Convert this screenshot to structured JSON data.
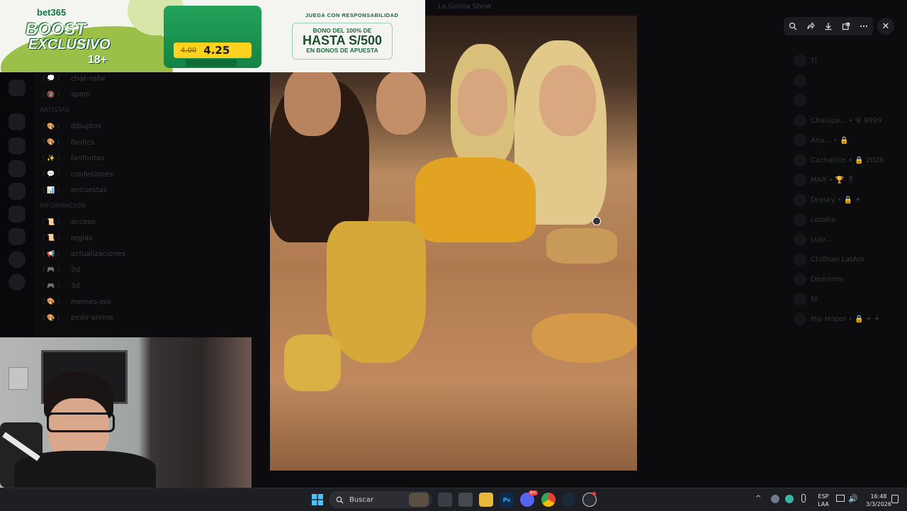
{
  "window": {
    "title": "La Gotita Show"
  },
  "sidebar": {
    "channels": [
      {
        "icon": "[ 💭 ]",
        "name": "chat-nsfw"
      },
      {
        "icon": "[ 🔞 ]",
        "name": "spam"
      },
      {
        "icon": "",
        "name": "ARTISTAS",
        "category": true
      },
      {
        "icon": "[ 🎨 ]",
        "name": "dibujitos"
      },
      {
        "icon": "[ 🎨 ]",
        "name": "fanfics"
      },
      {
        "icon": "[ ✨ ]",
        "name": "fanfontas"
      },
      {
        "icon": "[ 💬 ]",
        "name": "confesiones"
      },
      {
        "icon": "[ 📊 ]",
        "name": "encuestas"
      },
      {
        "icon": "",
        "name": "INFORMACION",
        "category": true
      },
      {
        "icon": "[ 📜 ]",
        "name": "acceso"
      },
      {
        "icon": "[ 📜 ]",
        "name": "reglas"
      },
      {
        "icon": "[ 📢 ]",
        "name": "actualizaciones"
      },
      {
        "icon": "[ 🎮 ]",
        "name": "2d"
      },
      {
        "icon": "[ 🎮 ]",
        "name": "3d"
      },
      {
        "icon": "[ 🎨 ]",
        "name": "memes-ero"
      },
      {
        "icon": "[ 🎨 ]",
        "name": "pedir-anime"
      }
    ]
  },
  "members": [
    {
      "name": "TI"
    },
    {
      "name": ""
    },
    {
      "name": ""
    },
    {
      "name": "Chalupa... • ♛ 9999"
    },
    {
      "name": "Ana... • 🔒"
    },
    {
      "name": "Cachalote • 🔒 2026"
    },
    {
      "name": "MAR • 🏆 🎖"
    },
    {
      "name": "Drasky • 🔒 ✦"
    },
    {
      "name": "Lozaho"
    },
    {
      "name": "Lujo..."
    },
    {
      "name": "Chillhan LatAm"
    },
    {
      "name": "Dedrenm"
    },
    {
      "name": "Ni"
    },
    {
      "name": "Hip Hoper • 🔒 ✦ ✦"
    }
  ],
  "ad": {
    "brand": "bet365",
    "headline1": "BOOST",
    "headline2": "EXCLUSIVO",
    "age": "18+",
    "old_odds": "4.00",
    "new_odds": "4.25",
    "slogan": "JUEGA CON RESPONSABILIDAD",
    "bono_line": "BONO DEL 100% DE",
    "hasta_line": "HASTA S/500",
    "bonos_line": "EN BONOS DE APUESTA"
  },
  "viewer": {
    "toolbar_icons": [
      "zoom-icon",
      "forward-icon",
      "download-icon",
      "open-external-icon",
      "more-icon"
    ],
    "close_glyph": "✕"
  },
  "taskbar": {
    "search_label": "Buscar",
    "discord_badge": "9+",
    "language": "ESP",
    "layout": "LAA",
    "time": "16:48",
    "date": "3/3/2026"
  },
  "colors": {
    "discord_bg": "#0c0c0e",
    "ad_green": "#138444",
    "ad_yellow": "#ffd21f",
    "taskbar_bg": "#1d1f24"
  }
}
